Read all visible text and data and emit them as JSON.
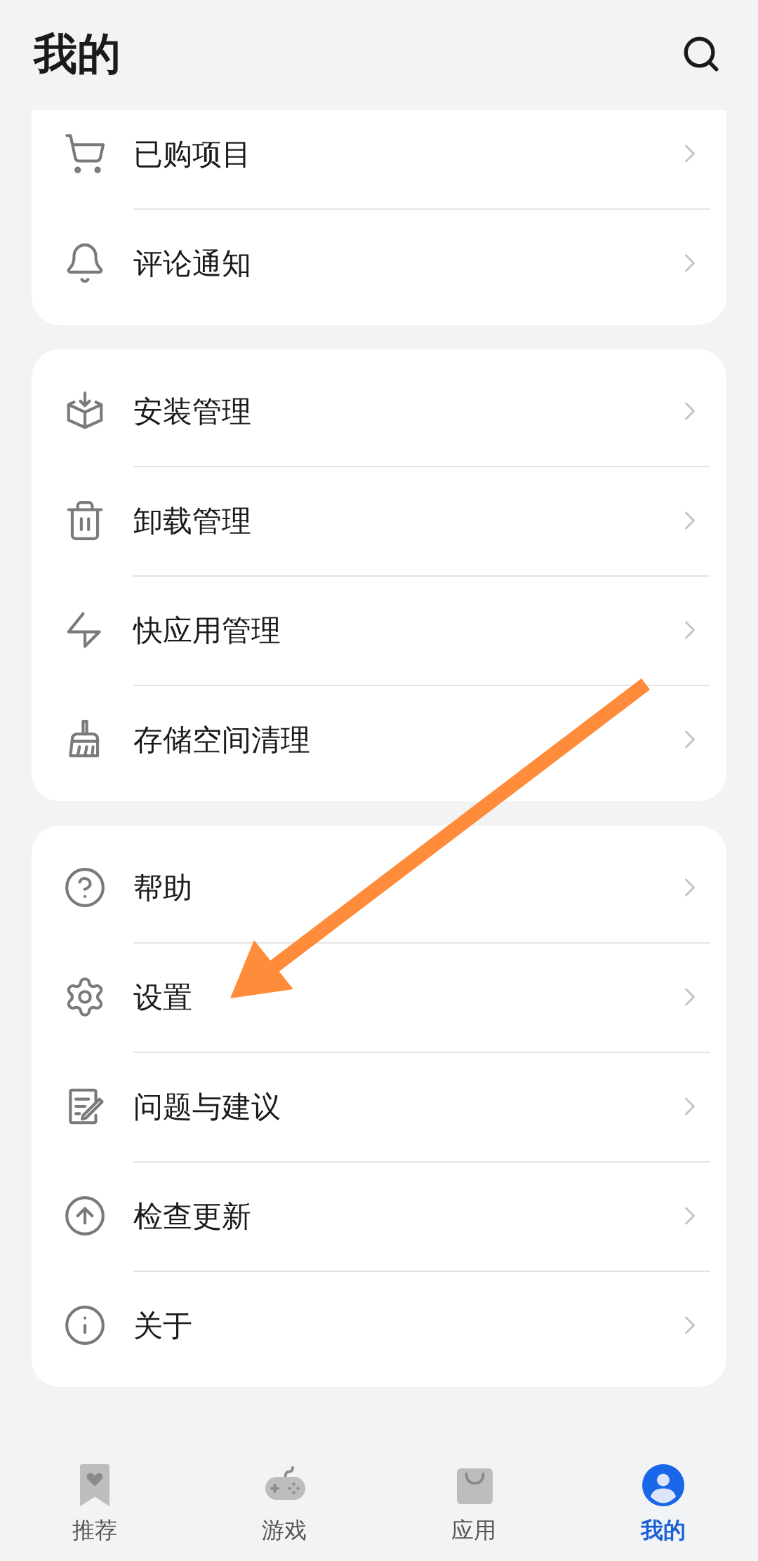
{
  "header": {
    "title": "我的"
  },
  "groups": [
    {
      "clipped_top": true,
      "items": [
        {
          "label": "已购项目"
        },
        {
          "label": "评论通知"
        }
      ]
    },
    {
      "clipped_top": false,
      "items": [
        {
          "label": "安装管理"
        },
        {
          "label": "卸载管理"
        },
        {
          "label": "快应用管理"
        },
        {
          "label": "存储空间清理"
        }
      ]
    },
    {
      "clipped_top": false,
      "items": [
        {
          "label": "帮助"
        },
        {
          "label": "设置"
        },
        {
          "label": "问题与建议"
        },
        {
          "label": "检查更新"
        },
        {
          "label": "关于"
        }
      ]
    }
  ],
  "bottom_nav": [
    {
      "label": "推荐",
      "selected": false
    },
    {
      "label": "游戏",
      "selected": false
    },
    {
      "label": "应用",
      "selected": false
    },
    {
      "label": "我的",
      "selected": true
    }
  ]
}
